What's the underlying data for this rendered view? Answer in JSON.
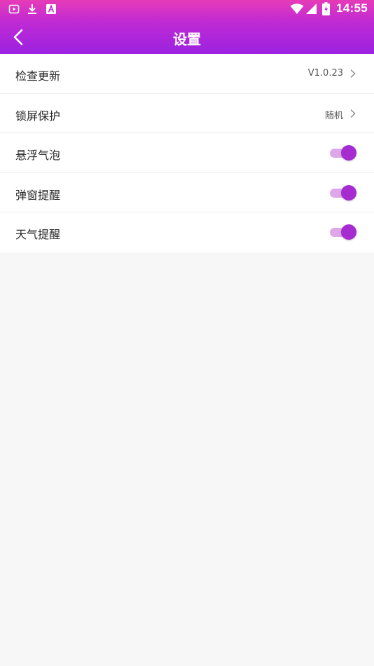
{
  "status_bar": {
    "time": "14:55",
    "left_icons": [
      "video-icon",
      "download-icon",
      "font-icon"
    ],
    "right_icons": [
      "wifi-icon",
      "signal-icon",
      "battery-icon"
    ]
  },
  "header": {
    "title": "设置",
    "back_icon": "back-arrow-icon"
  },
  "settings": {
    "items": [
      {
        "label": "检查更新",
        "type": "link",
        "value": "V1.0.23"
      },
      {
        "label": "锁屏保护",
        "type": "link",
        "value": "随机"
      },
      {
        "label": "悬浮气泡",
        "type": "toggle",
        "on": true
      },
      {
        "label": "弹窗提醒",
        "type": "toggle",
        "on": true
      },
      {
        "label": "天气提醒",
        "type": "toggle",
        "on": true
      }
    ]
  },
  "colors": {
    "header_gradient_top": "#e63bb8",
    "header_gradient_bottom": "#9b22e0",
    "toggle_thumb": "#a62bd0",
    "toggle_track": "#dda7e8",
    "background": "#f7f7f7"
  }
}
